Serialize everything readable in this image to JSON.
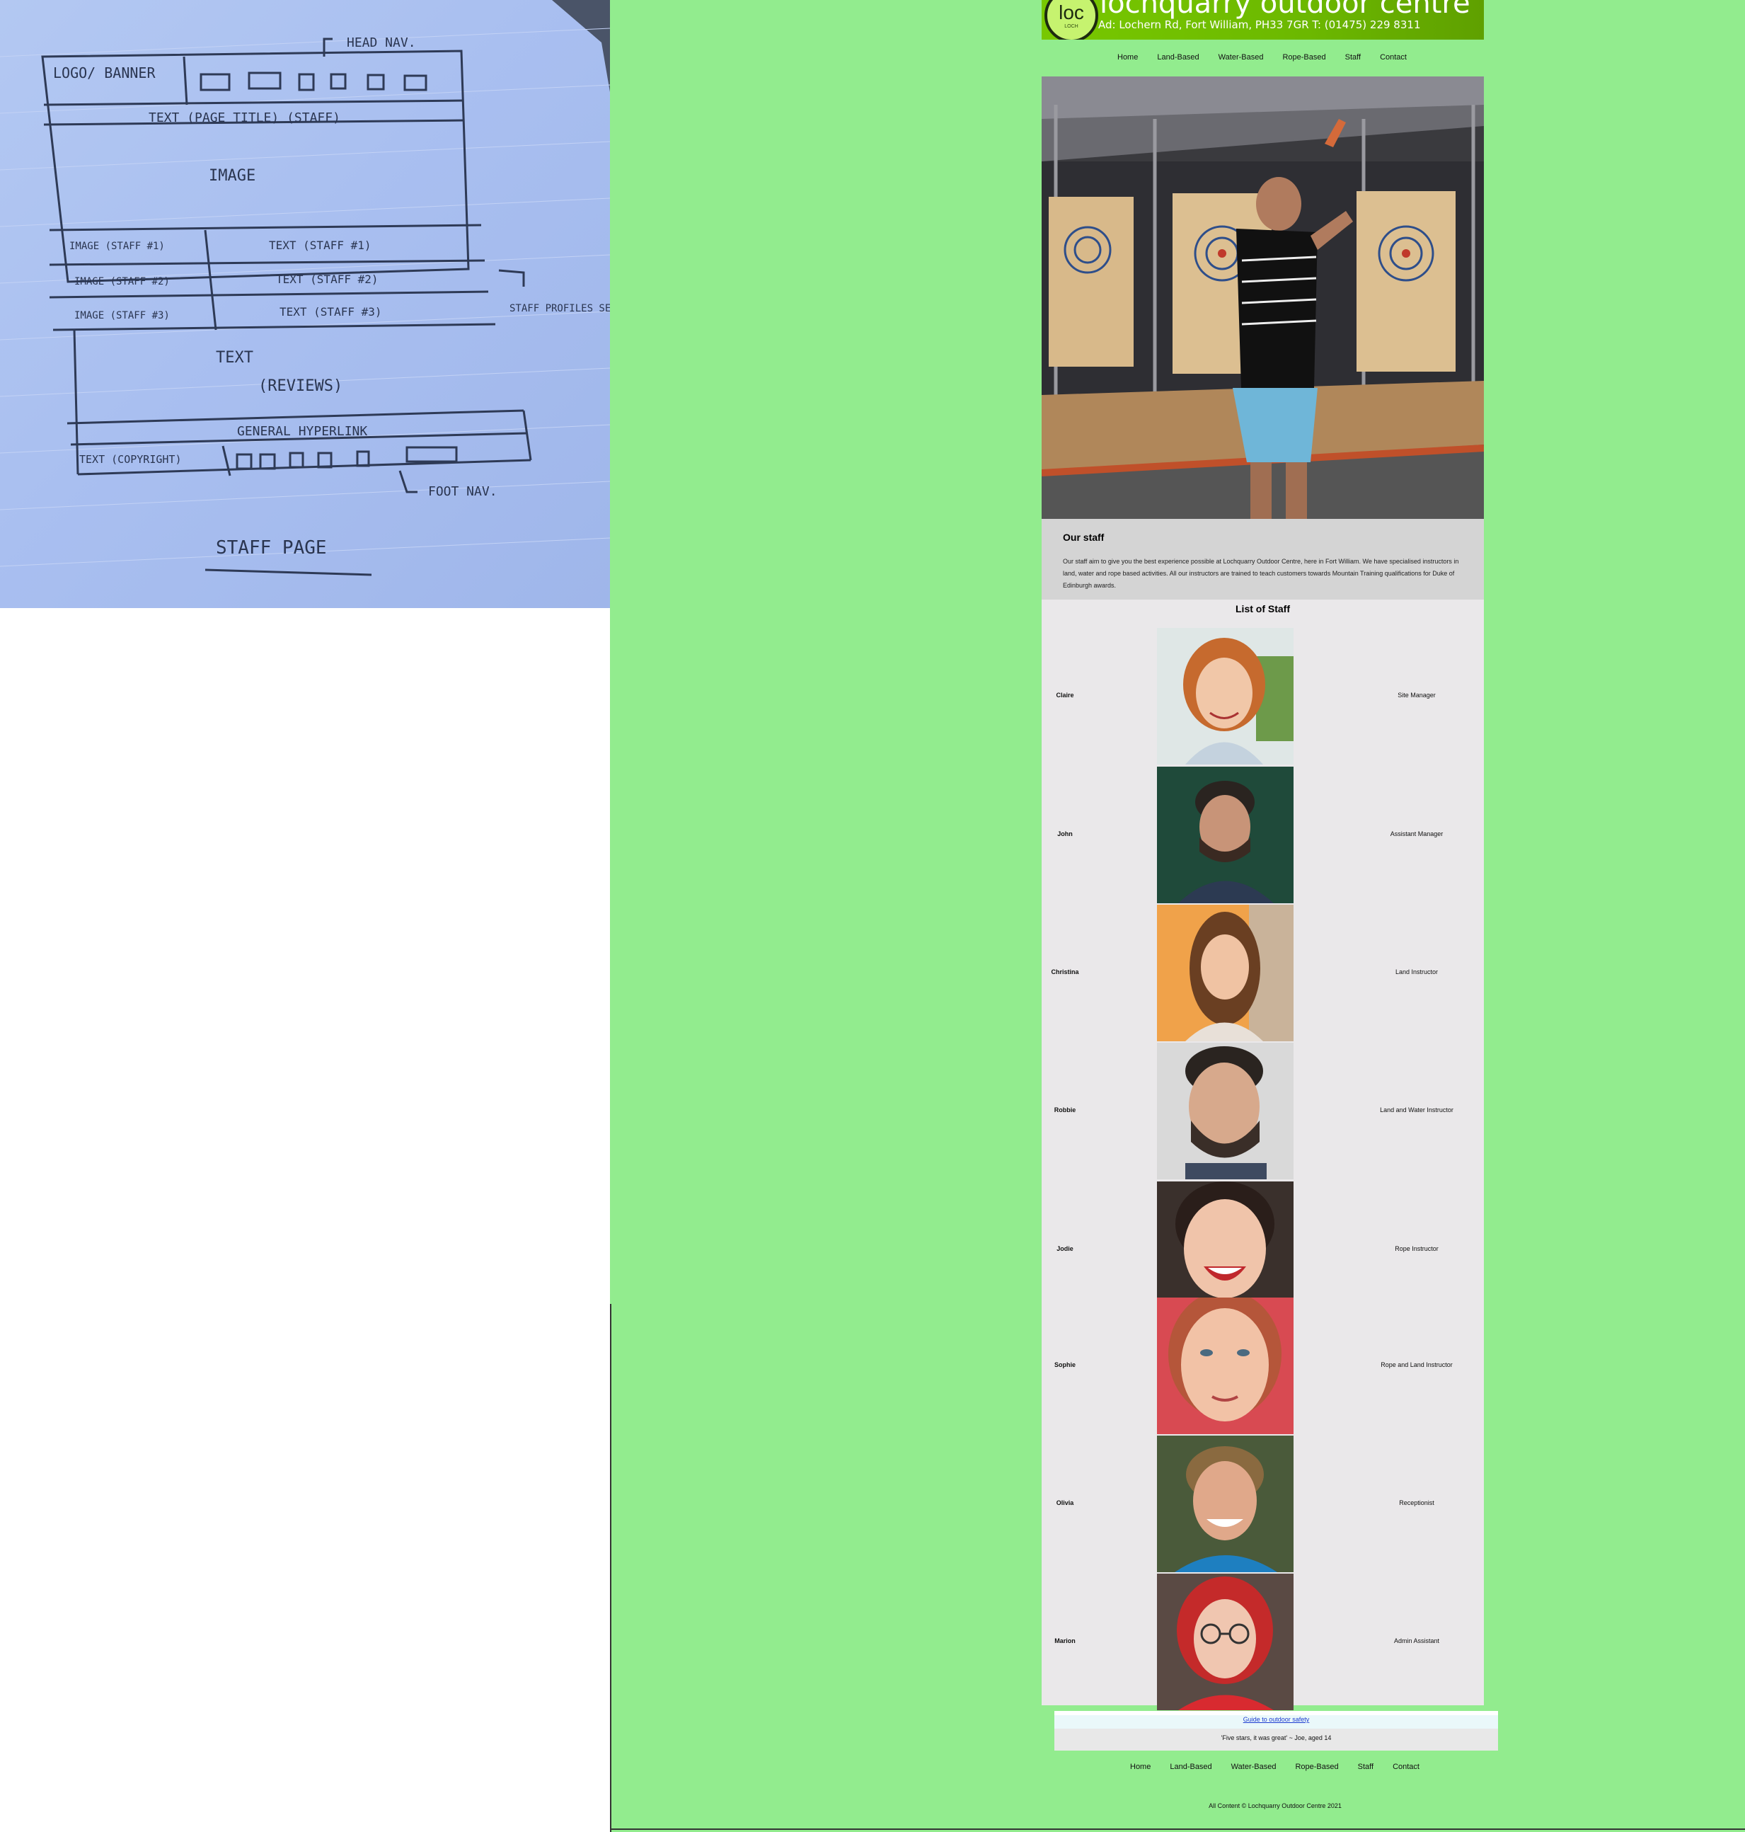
{
  "sketch": {
    "labels": {
      "logo_banner": "LOGO/ BANNER",
      "head_nav": "HEAD NAV.",
      "page_title": "TEXT (PAGE TITLE) (STAFF)",
      "image": "IMAGE",
      "image_staff_1": "IMAGE (STAFF #1)",
      "text_staff_1": "TEXT (STAFF #1)",
      "image_staff_2": "IMAGE (STAFF #2)",
      "text_staff_2": "TEXT (STAFF #2)",
      "image_staff_3": "IMAGE (STAFF #3)",
      "text_staff_3": "TEXT (STAFF #3)",
      "staff_profiles": "STAFF PROFILES SECTION.",
      "text": "TEXT",
      "reviews": "(REVIEWS)",
      "hyperlink": "GENERAL HYPERLINK",
      "copyright": "TEXT (COPYRIGHT)",
      "foot_nav": "FOOT NAV.",
      "page_name": "STAFF PAGE"
    }
  },
  "site": {
    "logo_text": "loc",
    "logo_sub": "LOCH",
    "title": "lochquarry outdoor centre",
    "address": "Ad: Lochern Rd, Fort William, PH33 7GR T: (01475) 229 8311"
  },
  "nav": [
    "Home",
    "Land-Based",
    "Water-Based",
    "Rope-Based",
    "Staff",
    "Contact"
  ],
  "intro": {
    "heading": "Our staff",
    "body": "Our staff aim to give you the best experience possible at Lochquarry Outdoor Centre, here in Fort William. We have specialised instructors in land, water and rope based activities. All our instructors are trained to teach customers towards Mountain Training qualifications for Duke of Edinburgh awards."
  },
  "staff": {
    "heading": "List of Staff",
    "members": [
      {
        "name": "Claire",
        "role": "Site Manager"
      },
      {
        "name": "John",
        "role": "Assistant Manager"
      },
      {
        "name": "Christina",
        "role": "Land Instructor"
      },
      {
        "name": "Robbie",
        "role": "Land and Water Instructor"
      },
      {
        "name": "Jodie",
        "role": "Rope Instructor"
      },
      {
        "name": "Sophie",
        "role": "Rope and Land Instructor"
      },
      {
        "name": "Olivia",
        "role": "Receptionist"
      },
      {
        "name": "Marion",
        "role": "Admin Assistant"
      }
    ]
  },
  "footer": {
    "guide_link": "Guide to outdoor safety",
    "review": "'Five stars, it was great' ~ Joe, aged 14",
    "copyright": "All Content © Lochquarry Outdoor Centre 2021"
  },
  "colors": {
    "page_background": "#92ec8e",
    "banner": "#6cb800",
    "panel": "#eae8ea"
  }
}
